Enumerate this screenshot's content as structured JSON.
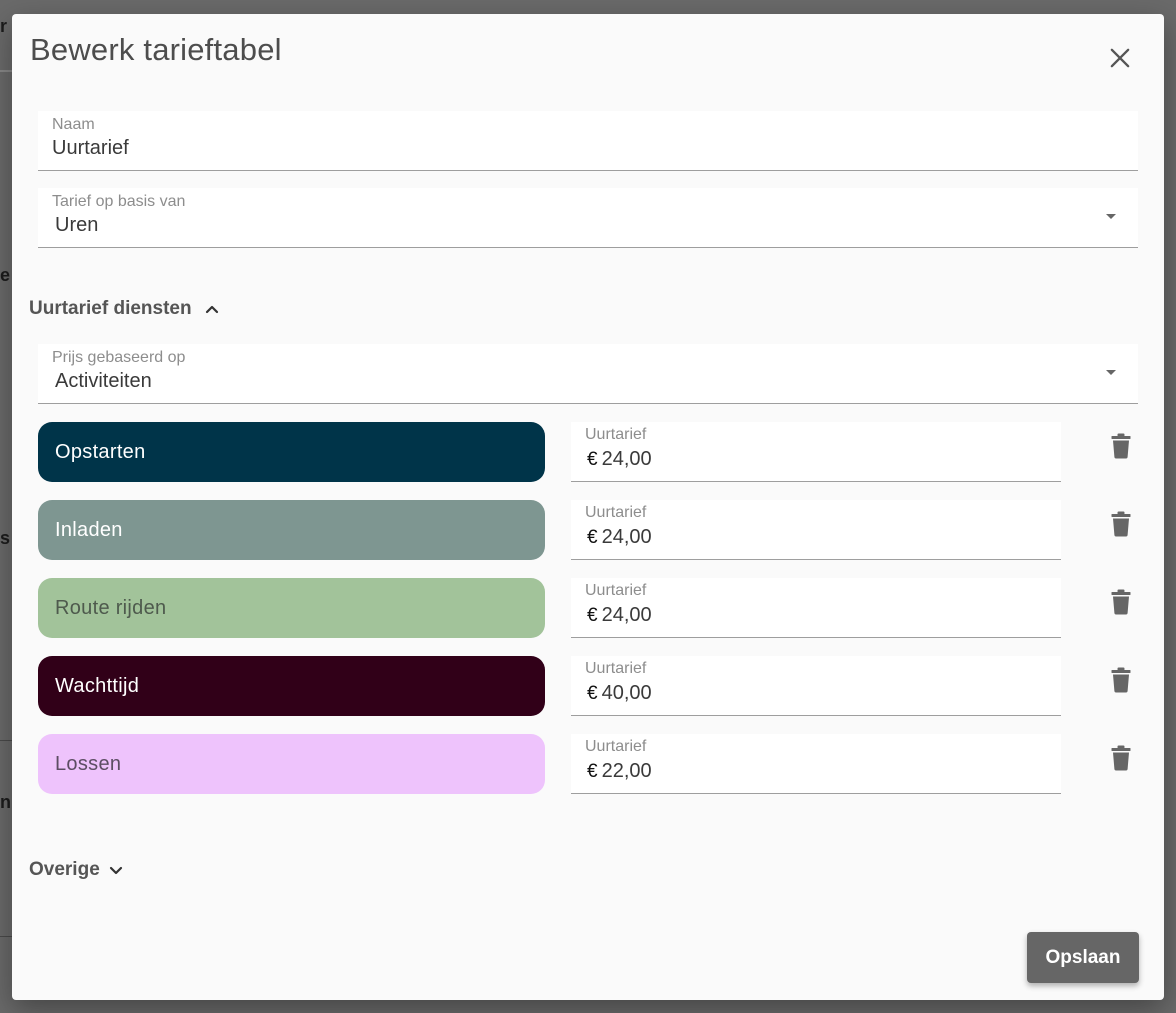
{
  "background": {
    "fragments": [
      "r",
      "e",
      "s",
      "n"
    ]
  },
  "dialog": {
    "title": "Bewerk tarieftabel",
    "close_icon": "close-icon"
  },
  "naam": {
    "label": "Naam",
    "value": "Uurtarief"
  },
  "tarief_basis": {
    "label": "Tarief op basis van",
    "value": "Uren"
  },
  "section_diensten": {
    "title": "Uurtarief diensten",
    "expanded": true
  },
  "prijs_basis": {
    "label": "Prijs gebaseerd op",
    "value": "Activiteiten"
  },
  "activities": [
    {
      "name": "Opstarten",
      "color": "#003449",
      "text_color": "#ffffff",
      "rate_label": "Uurtarief",
      "currency": "€",
      "rate": "24,00"
    },
    {
      "name": "Inladen",
      "color": "#7e9691",
      "text_color": "#ffffff",
      "rate_label": "Uurtarief",
      "currency": "€",
      "rate": "24,00"
    },
    {
      "name": "Route rijden",
      "color": "#a2c39a",
      "text_color": "#4e5a4d",
      "rate_label": "Uurtarief",
      "currency": "€",
      "rate": "24,00"
    },
    {
      "name": "Wachttijd",
      "color": "#310018",
      "text_color": "#ffffff",
      "rate_label": "Uurtarief",
      "currency": "€",
      "rate": "40,00"
    },
    {
      "name": "Lossen",
      "color": "#eec3fc",
      "text_color": "#5c4d63",
      "rate_label": "Uurtarief",
      "currency": "€",
      "rate": "22,00"
    }
  ],
  "section_overige": {
    "title": "Overige",
    "expanded": false
  },
  "save_button": {
    "label": "Opslaan"
  },
  "colors": {
    "dialog_bg": "#fafafa",
    "overlay": "#6a6a6a",
    "button_bg": "#666666"
  }
}
